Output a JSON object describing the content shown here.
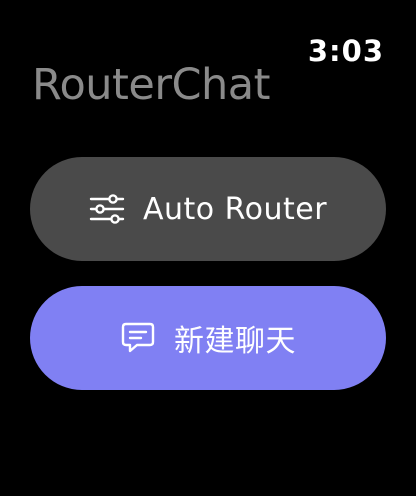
{
  "status": {
    "time": "3:03"
  },
  "app": {
    "title": "RouterChat"
  },
  "actions": {
    "auto_router": {
      "label": "Auto Router",
      "icon": "sliders-icon",
      "color": "#4a4a4a"
    },
    "new_chat": {
      "label": "新建聊天",
      "icon": "chat-bubble-icon",
      "color": "#8080f3"
    }
  }
}
